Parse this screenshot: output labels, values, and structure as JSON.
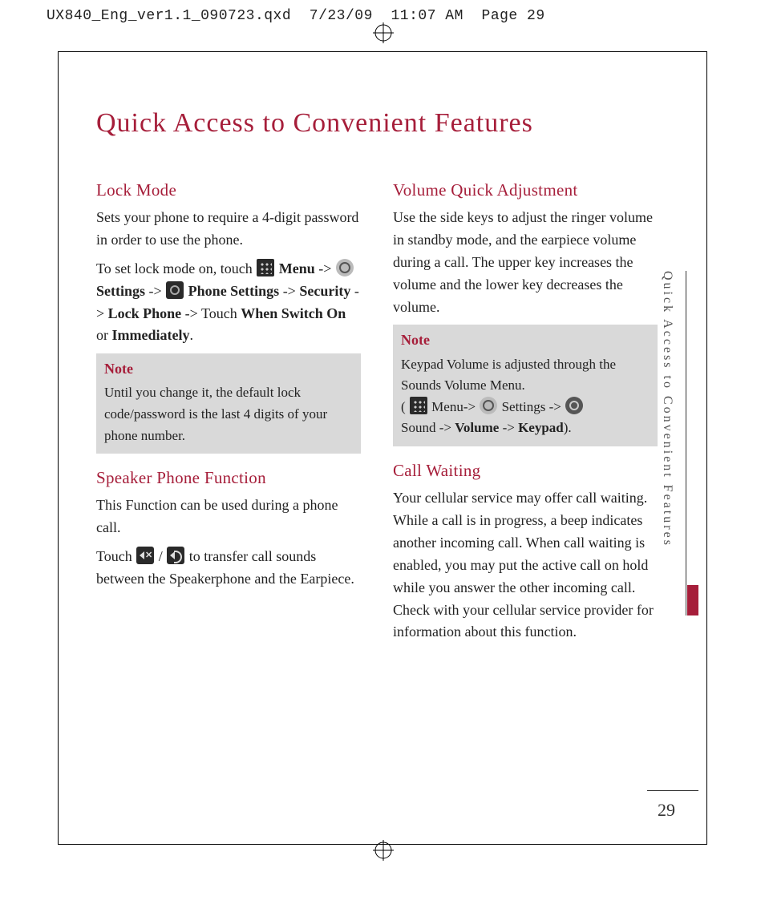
{
  "header": {
    "filename": "UX840_Eng_ver1.1_090723.qxd",
    "date": "7/23/09",
    "time": "11:07 AM",
    "page_label": "Page 29"
  },
  "page_title": "Quick Access to Convenient Features",
  "side_label": "Quick Access to Convenient Features",
  "page_number": "29",
  "s": {
    "lock": {
      "head": "Lock Mode",
      "p1": "Sets your phone to require a 4-digit password in order to use the phone.",
      "p2a": "To set lock mode on, touch ",
      "menu_b": "Menu",
      "arrow": " -> ",
      "settings_b": "Settings",
      "phone_settings_b": "Phone Settings",
      "security_b": "Security",
      "lock_phone_b": "Lock Phone",
      "touch_plain": " -> Touch  ",
      "when_b": "When Switch On",
      "or_plain": " or ",
      "imm_b": "Immediately",
      "period": ".",
      "note_head": "Note",
      "note_text": "Until you change it, the default lock code/password is the last 4 digits of your phone number."
    },
    "speaker": {
      "head": "Speaker Phone Function",
      "p1": "This Function can be used during a phone call.",
      "p2a": "Touch ",
      "slash": " / ",
      "p2b": " to transfer call sounds between the Speakerphone and the Earpiece."
    },
    "volume": {
      "head": "Volume Quick Adjustment",
      "p1": "Use the side keys to adjust the ringer volume in standby mode, and the earpiece volume during a call. The upper key increases the volume and the lower key decreases the volume.",
      "note_head": "Note",
      "note_l1": "Keypad Volume is adjusted through the Sounds Volume Menu.",
      "note_open": "( ",
      "menu_txt": " Menu-> ",
      "settings_txt": " Settings -> ",
      "sound_txt": " Sound -> ",
      "volume_b": "Volume",
      "arrow2": " -> ",
      "keypad_b": "Keypad",
      "close": ")."
    },
    "call": {
      "head": "Call Waiting",
      "p1": "Your cellular service may offer call waiting. While a call is in progress, a beep indicates another incoming call. When call waiting is enabled, you may put the active call on hold while you answer the other incoming call. Check with your cellular service provider for information about this function."
    }
  }
}
